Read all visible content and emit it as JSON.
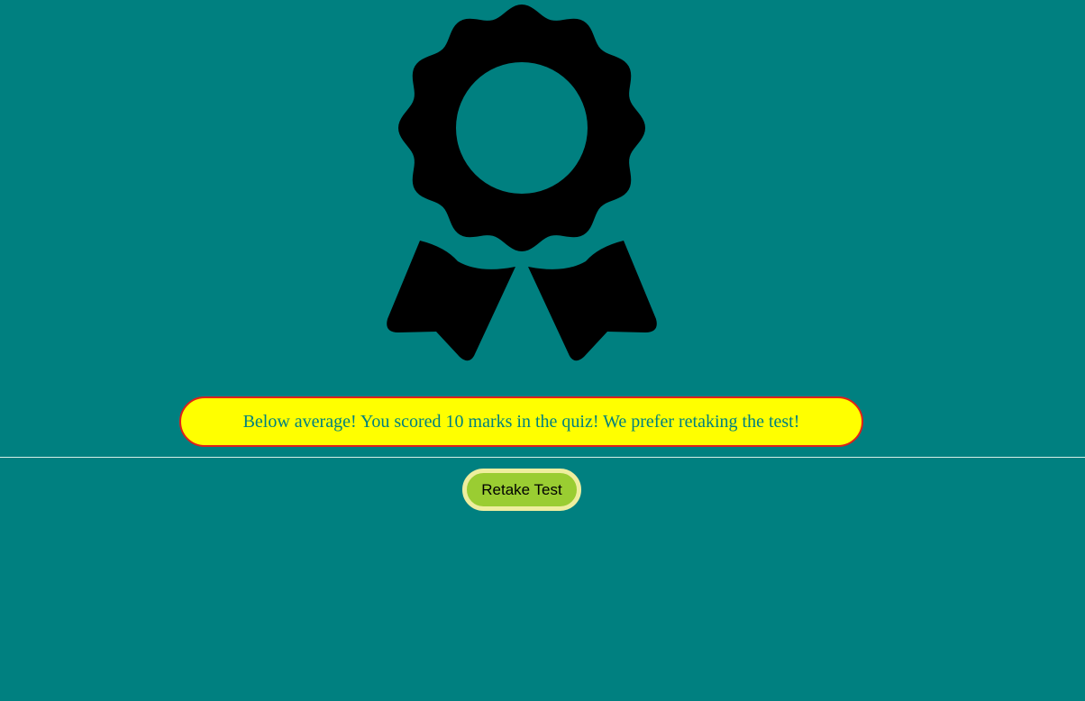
{
  "award": {
    "icon": "award-ribbon-icon"
  },
  "result": {
    "message": "Below average! You scored 10 marks in the quiz! We prefer retaking the test!"
  },
  "actions": {
    "retake_label": "Retake Test"
  },
  "colors": {
    "background": "#008080",
    "result_fill": "#ffff00",
    "result_border": "#e0201a",
    "result_text": "#008080",
    "button_fill": "#9acd32",
    "button_border": "#eeee9e"
  }
}
